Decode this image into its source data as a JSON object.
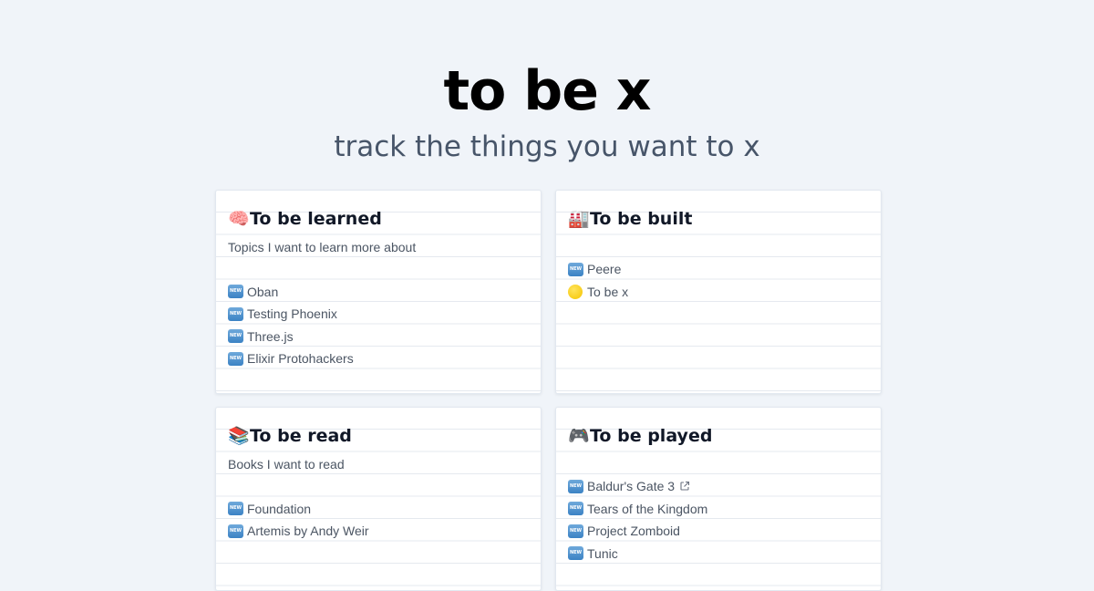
{
  "hero": {
    "title": "to be x",
    "subtitle": "track the things you want to x"
  },
  "cards": [
    {
      "emoji": "🧠",
      "title": "To be learned",
      "description": "Topics I want to learn more about",
      "items": [
        {
          "status": "new",
          "label": "Oban"
        },
        {
          "status": "new",
          "label": "Testing Phoenix"
        },
        {
          "status": "new",
          "label": "Three.js"
        },
        {
          "status": "new",
          "label": "Elixir Protohackers"
        }
      ]
    },
    {
      "emoji": "🏭",
      "title": "To be built",
      "description": "",
      "items": [
        {
          "status": "new",
          "label": "Peere"
        },
        {
          "status": "in-progress",
          "label": "To be x"
        }
      ]
    },
    {
      "emoji": "📚",
      "title": "To be read",
      "description": "Books I want to read",
      "items": [
        {
          "status": "new",
          "label": "Foundation"
        },
        {
          "status": "new",
          "label": "Artemis by Andy Weir"
        }
      ]
    },
    {
      "emoji": "🎮",
      "title": "To be played",
      "description": "",
      "items": [
        {
          "status": "new",
          "label": "Baldur's Gate 3",
          "external_link": true
        },
        {
          "status": "new",
          "label": "Tears of the Kingdom"
        },
        {
          "status": "new",
          "label": "Project Zomboid"
        },
        {
          "status": "new",
          "label": "Tunic"
        }
      ]
    }
  ],
  "badge_text": "NEW",
  "colors": {
    "background": "#f0f4f9",
    "card": "#ffffff",
    "rule_line": "#e5e9ef",
    "title": "#000000",
    "subtitle": "#475569",
    "item_text": "#4b5563",
    "badge": "#3b82c4",
    "in_progress_dot": "#f5c400"
  }
}
